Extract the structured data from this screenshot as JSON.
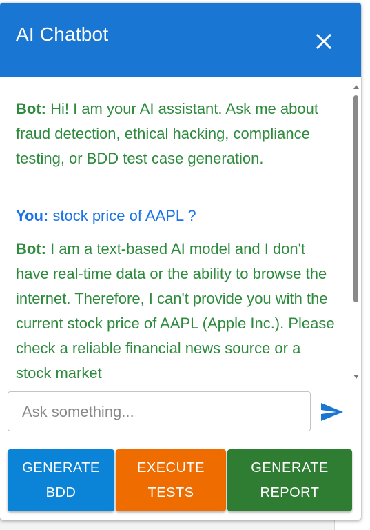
{
  "header": {
    "title": "AI Chatbot",
    "close_icon": "close-icon"
  },
  "messages": [
    {
      "speaker": "Bot:",
      "text": " Hi! I am your AI assistant. Ask me about fraud detection, ethical hacking, compliance testing, or BDD test case generation."
    },
    {
      "speaker": "You:",
      "text": " stock price of AAPL ?"
    },
    {
      "speaker": "Bot:",
      "text": " I am a text-based AI model and I don't have real-time data or the ability to browse the internet. Therefore, I can't provide you with the current stock price of AAPL (Apple Inc.). Please check a reliable financial news source or a stock market"
    }
  ],
  "input": {
    "placeholder": "Ask something...",
    "send_icon": "send-icon"
  },
  "actions": {
    "generate_bdd_line1": "GENERATE",
    "generate_bdd_line2": "BDD",
    "execute_tests_line1": "EXECUTE",
    "execute_tests_line2": "TESTS",
    "generate_report_line1": "GENERATE",
    "generate_report_line2": "REPORT"
  },
  "colors": {
    "header": "#1976d2",
    "bot_text": "#2e8b3e",
    "user_text": "#1a73e8",
    "generate_bdd": "#0b84d8",
    "execute_tests": "#ef6c00",
    "generate_report": "#2e7d32"
  }
}
